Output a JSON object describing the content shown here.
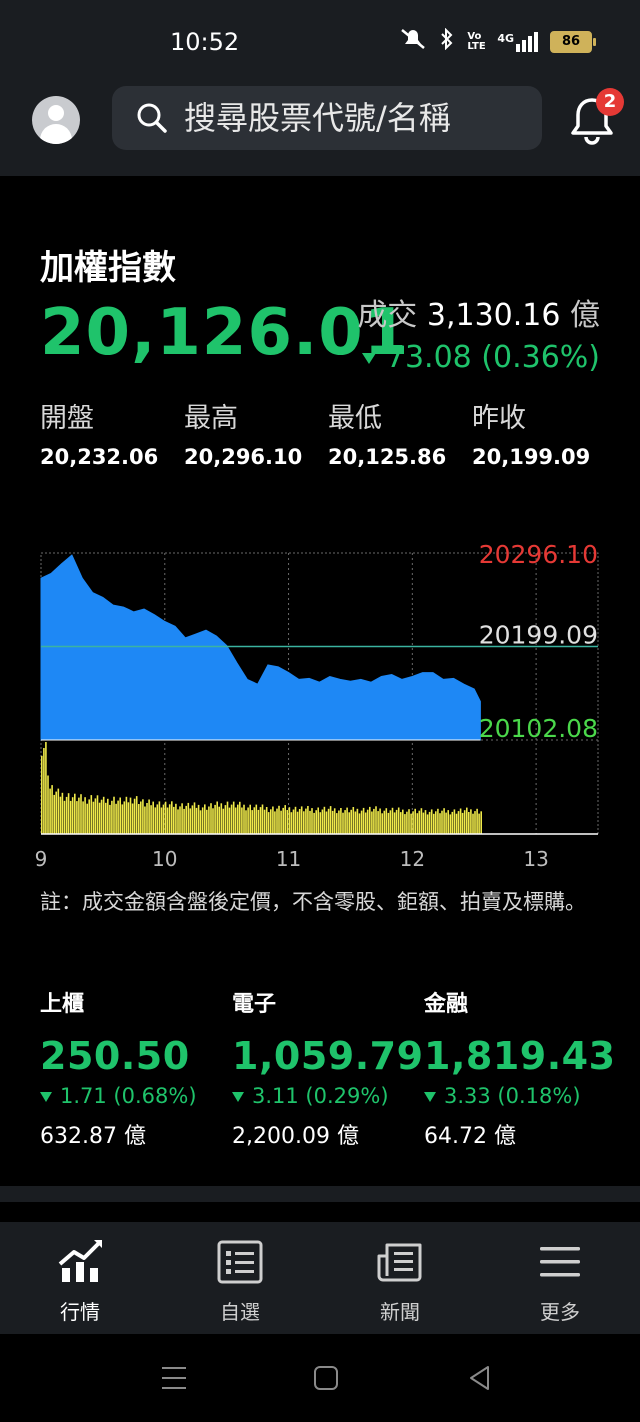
{
  "status_bar": {
    "time": "10:52",
    "network": "4G",
    "volte": "Vo LTE",
    "battery": "86"
  },
  "header": {
    "search_placeholder": "搜尋股票代號/名稱",
    "notification_count": "2"
  },
  "index": {
    "title": "加權指數",
    "price": "20,126.01",
    "volume_label": "成交",
    "volume_value": "3,130.16",
    "volume_unit": "億",
    "change": "73.08 (0.36%)",
    "change_direction": "down",
    "open_label": "開盤",
    "open": "20,232.06",
    "high_label": "最高",
    "high": "20,296.10",
    "low_label": "最低",
    "low": "20,125.86",
    "prev_label": "昨收",
    "prev": "20,199.09"
  },
  "chart_data": {
    "type": "area",
    "title": "",
    "x_ticks": [
      "9",
      "10",
      "11",
      "12",
      "13"
    ],
    "y_labels": {
      "top": "20296.10",
      "mid": "20199.09",
      "bottom": "20102.08"
    },
    "ylim": [
      20102.08,
      20296.1
    ],
    "reference_line": 20199.09,
    "x_range_minutes": [
      0,
      270
    ],
    "price_series": {
      "minutes": [
        0,
        5,
        10,
        15,
        20,
        25,
        30,
        35,
        40,
        45,
        50,
        55,
        60,
        65,
        70,
        75,
        80,
        85,
        90,
        95,
        100,
        105,
        110,
        115,
        120,
        125,
        130,
        135,
        140,
        145,
        150,
        155,
        160,
        165,
        170,
        175,
        180,
        185,
        190,
        195,
        200,
        205,
        210,
        213
      ],
      "values": [
        20270,
        20275,
        20285,
        20294,
        20270,
        20255,
        20250,
        20242,
        20240,
        20235,
        20238,
        20232,
        20225,
        20220,
        20208,
        20212,
        20216,
        20210,
        20200,
        20182,
        20165,
        20160,
        20180,
        20178,
        20172,
        20165,
        20166,
        20162,
        20168,
        20165,
        20163,
        20165,
        20162,
        20168,
        20170,
        20165,
        20168,
        20172,
        20172,
        20165,
        20166,
        20160,
        20155,
        20142
      ]
    },
    "volume_series": {
      "minutes": [
        0,
        2,
        4,
        8,
        12,
        16,
        20,
        25,
        30,
        35,
        40,
        45,
        50,
        55,
        60,
        70,
        80,
        90,
        100,
        110,
        120,
        130,
        140,
        150,
        160,
        170,
        180,
        190,
        200,
        210,
        213
      ],
      "values": [
        100,
        95,
        50,
        44,
        42,
        40,
        38,
        40,
        36,
        38,
        35,
        40,
        33,
        34,
        32,
        31,
        30,
        33,
        30,
        28,
        28,
        27,
        27,
        26,
        27,
        26,
        25,
        25,
        25,
        26,
        25
      ]
    }
  },
  "note": "註：成交金額含盤後定價，不含零股、鉅額、拍賣及標購。",
  "sub_indices": [
    {
      "name": "上櫃",
      "price": "250.50",
      "change": "1.71 (0.68%)",
      "volume": "632.87 億"
    },
    {
      "name": "電子",
      "price": "1,059.79",
      "change": "3.11 (0.29%)",
      "volume": "2,200.09 億"
    },
    {
      "name": "金融",
      "price": "1,819.43",
      "change": "3.33 (0.18%)",
      "volume": "64.72 億"
    }
  ],
  "nav": [
    {
      "label": "行情",
      "icon": "chart-icon"
    },
    {
      "label": "自選",
      "icon": "watchlist-icon"
    },
    {
      "label": "新聞",
      "icon": "news-icon"
    },
    {
      "label": "更多",
      "icon": "menu-icon"
    }
  ],
  "colors": {
    "up": "#e53935",
    "down": "#1fc36b",
    "area": "#1e88f5",
    "volume": "#f0ea4a",
    "reference": "#3bb3a0",
    "axis_top": "#e53935",
    "axis_bottom": "#4bd84b"
  }
}
